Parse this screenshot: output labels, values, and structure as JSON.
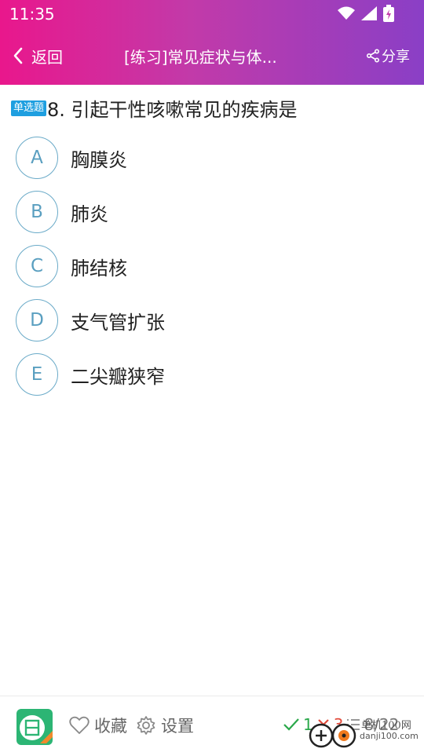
{
  "status_bar": {
    "time": "11:35"
  },
  "nav": {
    "back_label": "返回",
    "title": "[练习]常见症状与体...",
    "share_label": "分享"
  },
  "question": {
    "type_badge": "单选题",
    "text": "8. 引起干性咳嗽常见的疾病是"
  },
  "options": [
    {
      "letter": "A",
      "text": "胸膜炎"
    },
    {
      "letter": "B",
      "text": "肺炎"
    },
    {
      "letter": "C",
      "text": "肺结核"
    },
    {
      "letter": "D",
      "text": "支气管扩张"
    },
    {
      "letter": "E",
      "text": "二尖瓣狭窄"
    }
  ],
  "bottom": {
    "favorite_label": "收藏",
    "settings_label": "设置",
    "correct_count": "1",
    "wrong_count": "3",
    "progress": "8/22"
  },
  "watermark": {
    "line1": "单机100网",
    "line2": "danji100.com"
  },
  "colors": {
    "header_start": "#e9178c",
    "header_end": "#8a3fc6",
    "accent_blue": "#1f9fe0",
    "option_ring": "#6aaac8"
  },
  "icons": [
    "wifi-icon",
    "signal-icon",
    "battery-icon",
    "chevron-left-icon",
    "share-icon",
    "heart-icon",
    "gear-icon",
    "check-icon",
    "cross-icon",
    "list-icon"
  ]
}
